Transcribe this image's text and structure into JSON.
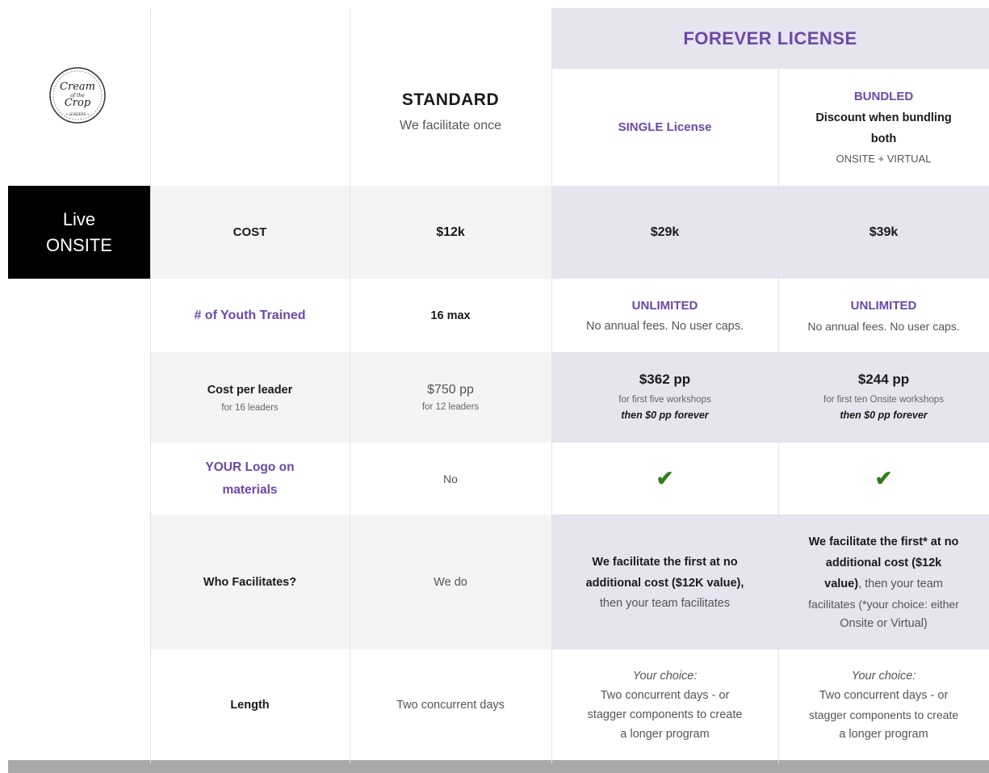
{
  "logo": {
    "text": "Cream of the Crop LEADERS"
  },
  "section_label": {
    "line1": "Live",
    "line2": "ONSITE"
  },
  "headers": {
    "forever": "FOREVER LICENSE",
    "standard_title": "STANDARD",
    "standard_sub": "We facilitate once",
    "single": "SINGLE License",
    "bundled": "BUNDLED",
    "bundled_line1": "Discount when bundling",
    "bundled_line2": "both",
    "bundled_line3": "ONSITE + VIRTUAL"
  },
  "rows": {
    "cost": {
      "label": "COST",
      "standard": "$12k",
      "single": "$29k",
      "bundled": "$39k"
    },
    "youth": {
      "label": "# of Youth Trained",
      "standard": "16 max",
      "single_title": "UNLIMITED",
      "single_sub": "No annual fees. No user caps.",
      "bundled_title": "UNLIMITED",
      "bundled_sub": "No annual fees. No user caps."
    },
    "per_leader": {
      "label": "Cost per leader",
      "label_sub": "for 16 leaders",
      "standard": "$750 pp",
      "standard_sub": "for 12 leaders",
      "single": "$362 pp",
      "single_sub": "for first five workshops",
      "single_note": "then $0 pp forever",
      "bundled": "$244 pp",
      "bundled_sub": "for first ten Onsite workshops",
      "bundled_note": "then $0 pp forever"
    },
    "logo": {
      "label_line1": "YOUR Logo on",
      "label_line2": "materials",
      "standard": "No",
      "single": "✔",
      "bundled": "✔"
    },
    "facilitates": {
      "label": "Who Facilitates?",
      "standard": "We do",
      "single_l1": "We facilitate the first at no",
      "single_l2": "additional cost ($12K value),",
      "single_l3": "then your team facilitates",
      "bundled_l1": "We facilitate the first* at no",
      "bundled_l2": "additional cost ($12k",
      "bundled_l3b": "value)",
      "bundled_l3": ", then your team",
      "bundled_l4": "facilitates (*your choice: either",
      "bundled_l5": "Onsite or Virtual)"
    },
    "length": {
      "label": "Length",
      "standard": "Two concurrent days",
      "single_l1": "Your choice:",
      "single_l2": "Two concurrent days - or",
      "single_l3": "stagger components to create",
      "single_l4": "a longer program",
      "bundled_l1": "Your choice:",
      "bundled_l2": "Two concurrent days - or",
      "bundled_l3": "stagger components to create",
      "bundled_l4": "a longer program"
    }
  }
}
